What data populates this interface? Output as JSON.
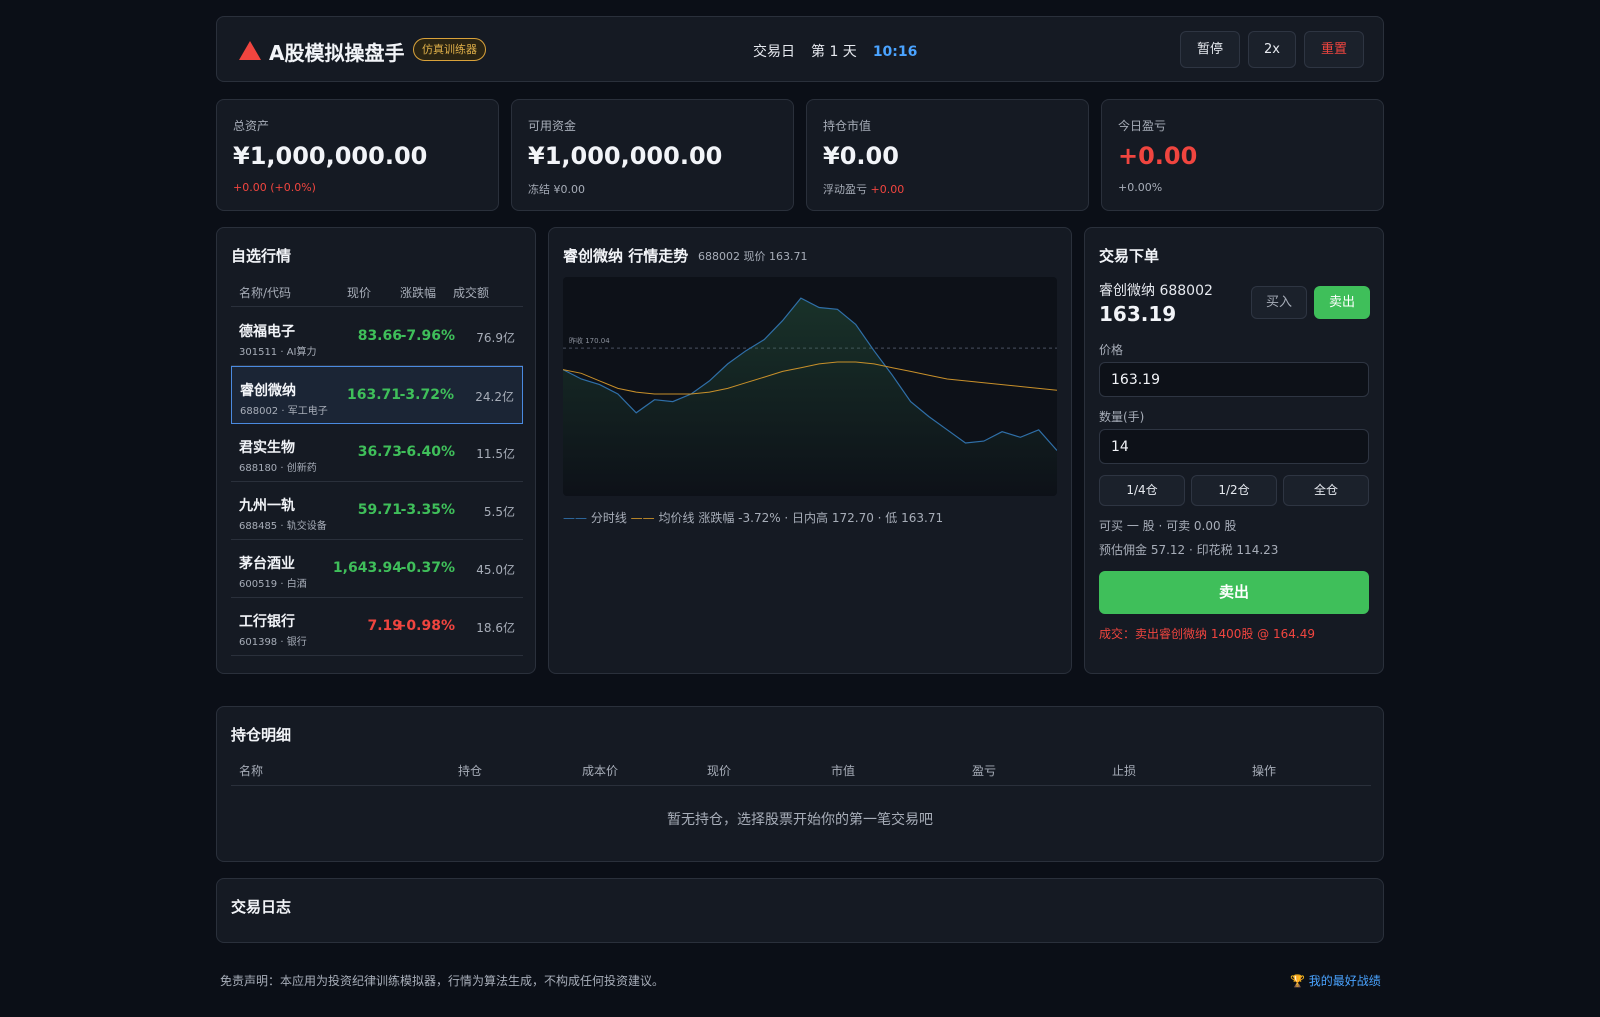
{
  "header": {
    "app_title": "A股模拟操盘手",
    "badge": "仿真训练器",
    "trade_day_label": "交易日",
    "day": "第 1 天",
    "clock": "10:16",
    "pause_label": "暂停",
    "speed_label": "2x",
    "reset_label": "重置"
  },
  "stats": [
    {
      "label": "总资产",
      "value": "¥1,000,000.00",
      "sub": "+0.00 (+0.0%)"
    },
    {
      "label": "可用资金",
      "value": "¥1,000,000.00",
      "sub": "冻结 ¥0.00"
    },
    {
      "label": "持仓市值",
      "value": "¥0.00",
      "sub_prefix": "浮动盈亏 ",
      "sub_value": "+0.00"
    },
    {
      "label": "今日盈亏",
      "value": "+0.00",
      "sub": "+0.00%"
    }
  ],
  "watchlist": {
    "title": "自选行情",
    "columns": [
      "名称/代码",
      "现价",
      "涨跌幅",
      "成交额"
    ],
    "rows": [
      {
        "name": "德福电子",
        "code": "301511 · AI算力",
        "price": "83.66",
        "pct": "-7.96%",
        "volume": "76.9亿"
      },
      {
        "name": "睿创微纳",
        "code": "688002 · 军工电子",
        "price": "163.71",
        "pct": "-3.72%",
        "volume": "24.2亿"
      },
      {
        "name": "君实生物",
        "code": "688180 · 创新药",
        "price": "36.73",
        "pct": "-6.40%",
        "volume": "11.5亿"
      },
      {
        "name": "九州一轨",
        "code": "688485 · 轨交设备",
        "price": "59.71",
        "pct": "-3.35%",
        "volume": "5.5亿"
      },
      {
        "name": "茅台酒业",
        "code": "600519 · 白酒",
        "price": "1,643.94",
        "pct": "-0.37%",
        "volume": "45.0亿"
      },
      {
        "name": "工行银行",
        "code": "601398 · 银行",
        "price": "7.19",
        "pct": "+0.98%",
        "volume": "18.6亿"
      }
    ]
  },
  "chart": {
    "title": "睿创微纳 行情走势",
    "meta": "688002 现价 163.71",
    "prev_close_label": "昨收 170.04",
    "legend_minute": "分时线",
    "legend_avg": "均价线",
    "legend_stats": "涨跌幅 -3.72% · 日内高 172.70 · 低 163.71"
  },
  "chart_data": {
    "type": "line",
    "title": "睿创微纳 行情走势",
    "y_reference": 170.04,
    "ylim": [
      162.5,
      173.5
    ],
    "series": [
      {
        "name": "分时线",
        "values": [
          168.9,
          168.4,
          168.1,
          167.6,
          166.6,
          167.3,
          167.2,
          167.6,
          168.3,
          169.2,
          169.9,
          170.5,
          171.5,
          172.7,
          172.2,
          172.1,
          171.3,
          169.9,
          168.6,
          167.2,
          166.4,
          165.7,
          165.0,
          165.1,
          165.6,
          165.3,
          165.7,
          164.6
        ]
      },
      {
        "name": "均价线",
        "values": [
          168.9,
          168.7,
          168.3,
          167.9,
          167.7,
          167.6,
          167.6,
          167.6,
          167.7,
          167.9,
          168.2,
          168.5,
          168.8,
          169.0,
          169.2,
          169.3,
          169.3,
          169.2,
          169.0,
          168.8,
          168.6,
          168.4,
          168.3,
          168.2,
          168.1,
          168.0,
          167.9,
          167.8
        ]
      }
    ]
  },
  "trade": {
    "title": "交易下单",
    "stock": "睿创微纳 688002",
    "price": "163.19",
    "buy_label": "买入",
    "sell_label": "卖出",
    "price_label": "价格",
    "price_value": "163.19",
    "qty_label": "数量(手)",
    "qty_value": "14",
    "q1": "1/4仓",
    "q2": "1/2仓",
    "q3": "全仓",
    "avail": "可买 一 股 · 可卖 0.00 股",
    "fees": "预估佣金 57.12 · 印花税 114.23",
    "submit_label": "卖出",
    "result": "成交：卖出睿创微纳 1400股 @ 164.49"
  },
  "positions": {
    "title": "持仓明细",
    "columns": [
      "名称",
      "持仓",
      "成本价",
      "现价",
      "市值",
      "盈亏",
      "止损",
      "操作"
    ],
    "empty": "暂无持仓，选择股票开始你的第一笔交易吧"
  },
  "log": {
    "title": "交易日志"
  },
  "footer": {
    "disclaimer": "免责声明：本应用为投资纪律训练模拟器，行情为算法生成，不构成任何投资建议。",
    "best_record": "🏆 我的最好战绩"
  },
  "colors": {
    "up": "#f0453f",
    "down": "#3fbf5a",
    "accent": "#4aa3ff",
    "minute_line": "#2f6fa8",
    "avg_line": "#c8902a"
  }
}
